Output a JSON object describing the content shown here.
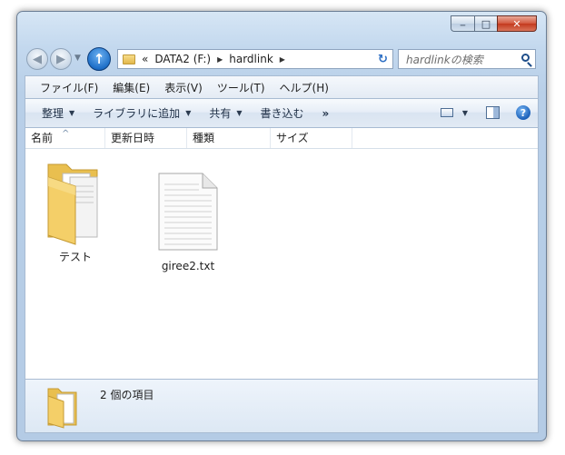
{
  "window": {
    "caption_buttons": {
      "minimize_glyph": "─",
      "maximize_glyph": "□",
      "close_glyph": "✕"
    }
  },
  "nav": {
    "back_glyph": "◀",
    "forward_glyph": "▶",
    "history_glyph": "▼",
    "up_glyph": "↑",
    "address": {
      "overflow": "«",
      "crumbs": [
        "DATA2 (F:)",
        "hardlink"
      ],
      "separator_glyph": "▶",
      "dropdown_glyph": "▼"
    },
    "refresh_glyph": "↻",
    "search_placeholder": "hardlinkの検索"
  },
  "menubar": {
    "items": [
      "ファイル(F)",
      "編集(E)",
      "表示(V)",
      "ツール(T)",
      "ヘルプ(H)"
    ]
  },
  "commandbar": {
    "organize": "整理",
    "library": "ライブラリに追加",
    "share": "共有",
    "burn": "書き込む",
    "more": "»",
    "arrow_glyph": "▼",
    "help_glyph": "?"
  },
  "columns": {
    "name": "名前",
    "sort_glyph": "^",
    "date": "更新日時",
    "type": "種類",
    "size": "サイズ"
  },
  "files": [
    {
      "name": "テスト",
      "kind": "folder-icon"
    },
    {
      "name": "giree2.txt",
      "kind": "text-file-icon"
    }
  ],
  "details": {
    "count_text": "2 個の項目"
  },
  "colors": {
    "accent": "#2d6fc4",
    "frame": "#b8cfe8",
    "folder": "#f0c95c",
    "close": "#c3391d"
  }
}
